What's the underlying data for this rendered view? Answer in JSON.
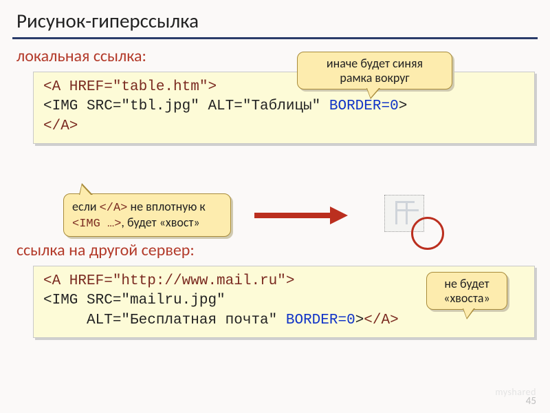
{
  "title": "Рисунок-гиперссылка",
  "sections": {
    "local": {
      "label": "локальная ссылка:",
      "code": {
        "l1a": "<A HREF=\"table.htm\">",
        "l2a": "<IMG SRC=\"tbl.jpg\" ALT=\"Таблицы\" ",
        "l2b": "BORDER=0",
        "l2c": ">",
        "l3a": "</A>"
      }
    },
    "remote": {
      "label": "ссылка на другой сервер:",
      "code": {
        "l1a": "<A HREF=\"http://www.mail.ru\">",
        "l2a": "<IMG SRC=\"mailru.jpg\"",
        "l3a": "     ALT=\"Бесплатная почта\" ",
        "l3b": "BORDER=0",
        "l3c": ">",
        "l3d": "</A>"
      }
    }
  },
  "callouts": {
    "top": {
      "line1": "иначе будет синяя",
      "line2": "рамка вокруг"
    },
    "mid": {
      "pre": "если ",
      "tag1": "</A>",
      "mid": " не вплотную к",
      "tag2": "<IMG …>",
      "post": ", будет «хвост»"
    },
    "right": {
      "line1": "не будет",
      "line2": "«хвоста»"
    }
  },
  "pagenum": "45",
  "watermark": "myshared"
}
